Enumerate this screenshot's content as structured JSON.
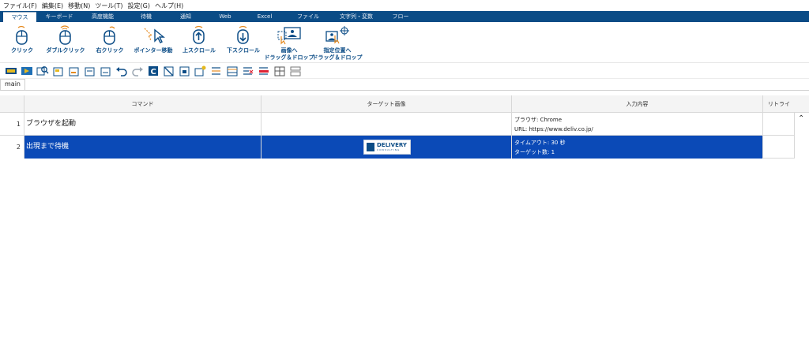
{
  "menu": [
    "ファイル(F)",
    "編集(E)",
    "移動(N)",
    "ツール(T)",
    "設定(G)",
    "ヘルプ(H)"
  ],
  "tabs": [
    "マウス",
    "キーボード",
    "高度機能",
    "待機",
    "通知",
    "Web",
    "Excel",
    "ファイル",
    "文字列・変数",
    "フロー"
  ],
  "ribbon": [
    {
      "label": "クリック",
      "icon": "mouse-click-icon"
    },
    {
      "label": "ダブルクリック",
      "icon": "mouse-double-click-icon"
    },
    {
      "label": "右クリック",
      "icon": "mouse-right-click-icon"
    },
    {
      "label": "ポインター移動",
      "icon": "pointer-move-icon"
    },
    {
      "label": "上スクロール",
      "icon": "scroll-up-icon"
    },
    {
      "label": "下スクロール",
      "icon": "scroll-down-icon"
    },
    {
      "label1": "画像へ",
      "label2": "ドラッグ＆ドロップ",
      "icon": "drag-to-image-icon"
    },
    {
      "label1": "指定位置へ",
      "label2": "ドラッグ＆ドロップ",
      "icon": "drag-to-position-icon"
    }
  ],
  "doc_tab": "main",
  "columns": {
    "command": "コマンド",
    "target": "ターゲット画像",
    "input": "入力内容",
    "retry": "リトライ"
  },
  "rows": [
    {
      "num": "1",
      "command": "ブラウザを起動",
      "input1": "ブラウザ: Chrome",
      "input2": "URL: https://www.deliv.co.jp/"
    },
    {
      "num": "2",
      "command": "出現まで待機",
      "input1": "タイムアウト: 30 秒",
      "input2": "ターゲット数: 1"
    }
  ],
  "logo": {
    "line1": "DELIVERY",
    "line2": "CONSULTING"
  },
  "colors": {
    "accent": "#0b4c86",
    "selection": "#0b4ab7"
  }
}
